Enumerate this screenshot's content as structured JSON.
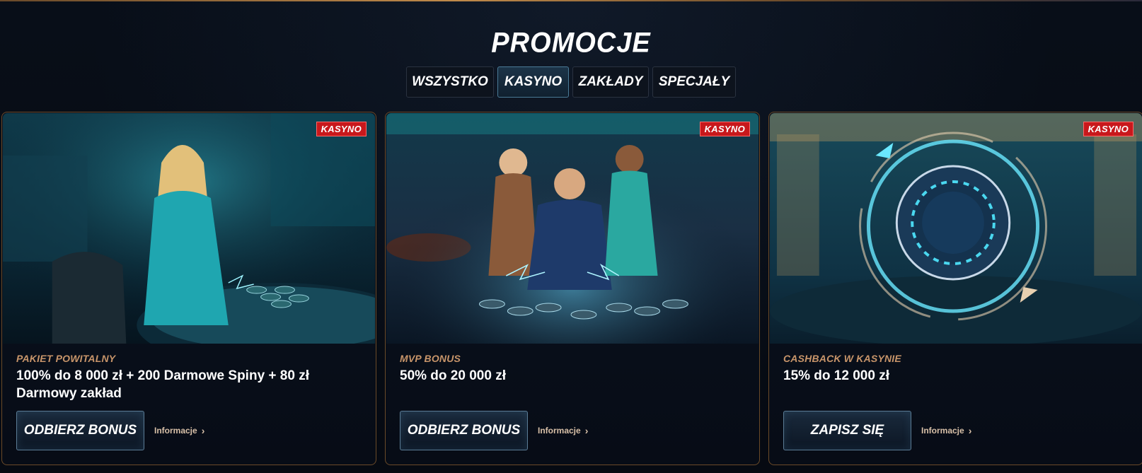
{
  "header": {
    "title": "PROMOCJE"
  },
  "tabs": [
    {
      "label": "WSZYSTKO",
      "active": false
    },
    {
      "label": "KASYNO",
      "active": true
    },
    {
      "label": "ZAKŁADY",
      "active": false
    },
    {
      "label": "SPECJAŁY",
      "active": false
    }
  ],
  "cards": [
    {
      "badge": "KASYNO",
      "subtitle": "PAKIET POWITALNY",
      "title": "100% do 8 000 zł + 200 Darmowe Spiny + 80 zł Darmowy zakład",
      "button": "ODBIERZ BONUS",
      "info": "Informacje",
      "icon": "woman-casino-image"
    },
    {
      "badge": "KASYNO",
      "subtitle": "MVP BONUS",
      "title": "50% do 20 000 zł",
      "button": "ODBIERZ BONUS",
      "info": "Informacje",
      "icon": "mvp-casino-image"
    },
    {
      "badge": "KASYNO",
      "subtitle": "CASHBACK W KASYNIE",
      "title": "15% do 12 000 zł",
      "button": "ZAPISZ SIĘ",
      "info": "Informacje",
      "icon": "cashback-chip-image"
    }
  ],
  "colors": {
    "accent_gold": "#c8956a",
    "badge_red": "#c8181c",
    "background": "#060b14",
    "teal": "#2ab3c8"
  }
}
